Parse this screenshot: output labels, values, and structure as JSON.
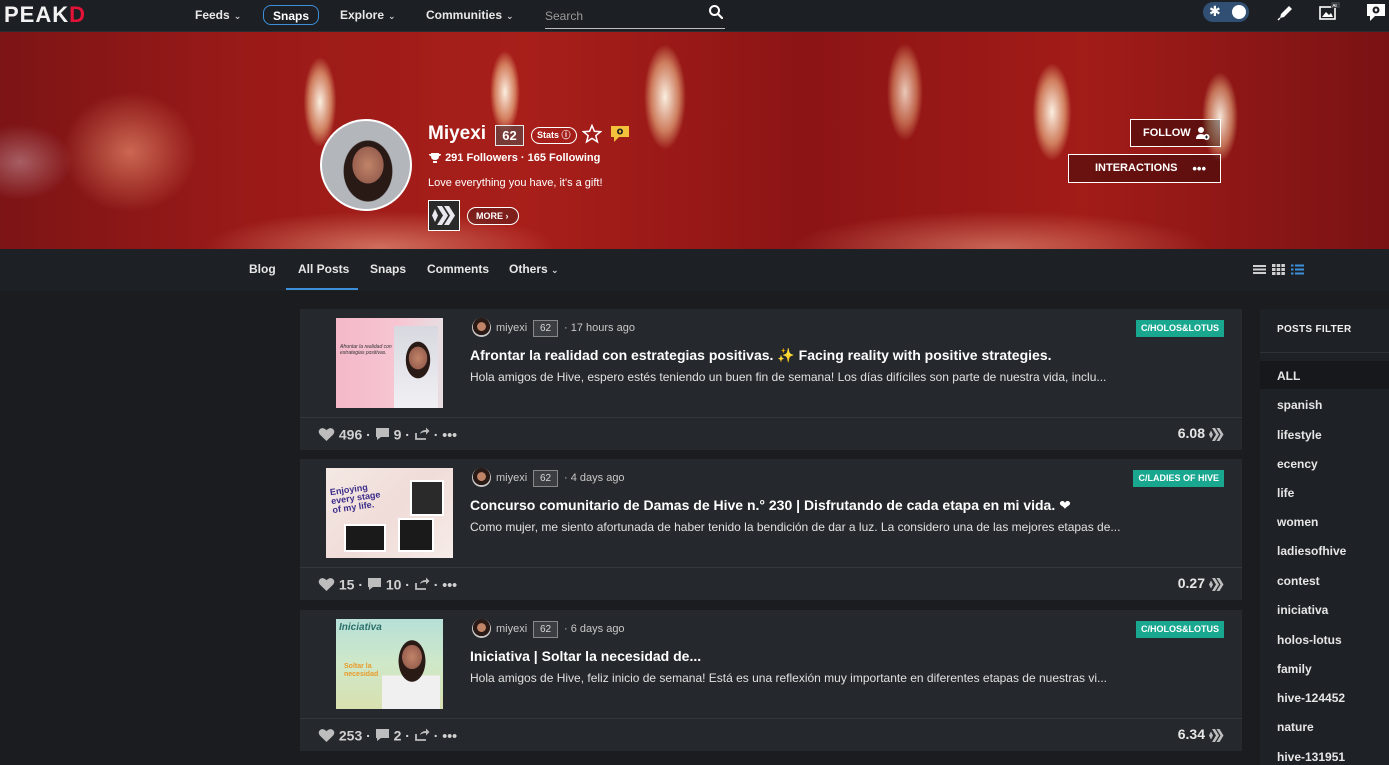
{
  "brand": {
    "logo_pre": "PE",
    "logo_a": "A",
    "logo_k": "K",
    "logo_d": "D"
  },
  "nav": {
    "feeds": "Feeds",
    "snaps": "Snaps",
    "explore": "Explore",
    "communities": "Communities",
    "search_placeholder": "Search"
  },
  "profile": {
    "name": "Miyexi",
    "reputation": "62",
    "stats_label": "Stats",
    "followers": "291 Followers",
    "following": "165 Following",
    "bio": "Love everything you have, it's a gift!",
    "more_label": "MORE",
    "follow_label": "FOLLOW",
    "interactions_label": "INTERACTIONS"
  },
  "tabs": [
    {
      "label": "Blog"
    },
    {
      "label": "All Posts"
    },
    {
      "label": "Snaps"
    },
    {
      "label": "Comments"
    },
    {
      "label": "Others"
    }
  ],
  "posts": [
    {
      "author": "miyexi",
      "rep": "62",
      "time": "17 hours ago",
      "community": "C/HOLOS&LOTUS",
      "title": "Afrontar la realidad con estrategias positivas. ✨ Facing reality with positive strategies.",
      "excerpt": "Hola amigos de Hive, espero estés teniendo un buen fin de semana! Los días difíciles son parte de nuestra vida, inclu...",
      "votes": "496",
      "comments": "9",
      "payout": "6.08",
      "thumb_text": "Afrontar la realidad con estrategias positivas."
    },
    {
      "author": "miyexi",
      "rep": "62",
      "time": "4 days ago",
      "community": "C/LADIES OF HIVE",
      "title": "Concurso comunitario de Damas de Hive n.° 230 | Disfrutando de cada etapa en mi vida. ❤",
      "excerpt": "Como mujer, me siento afortunada de haber tenido la bendición de dar a luz. La considero una de las mejores etapas de...",
      "votes": "15",
      "comments": "10",
      "payout": "0.27",
      "thumb_text": "Enjoying every stage of my life."
    },
    {
      "author": "miyexi",
      "rep": "62",
      "time": "6 days ago",
      "community": "C/HOLOS&LOTUS",
      "title": "Iniciativa | Soltar la necesidad de...",
      "excerpt": "Hola amigos de Hive, feliz inicio de semana! Está es una reflexión muy importante en diferentes etapas de nuestras vi...",
      "votes": "253",
      "comments": "2",
      "payout": "6.34",
      "thumb_text": "Iniciativa",
      "thumb_text2": "Soltar la necesidad"
    }
  ],
  "filter": {
    "title": "POSTS FILTER",
    "items": [
      "ALL",
      "spanish",
      "lifestyle",
      "ecency",
      "life",
      "women",
      "ladiesofhive",
      "contest",
      "iniciativa",
      "holos-lotus",
      "family",
      "hive-124452",
      "nature",
      "hive-131951"
    ]
  },
  "colors": {
    "accent": "#3d8fd9",
    "community_badge": "#1aa78f",
    "brand_red": "#e31337",
    "heart_red": "#e31337"
  }
}
